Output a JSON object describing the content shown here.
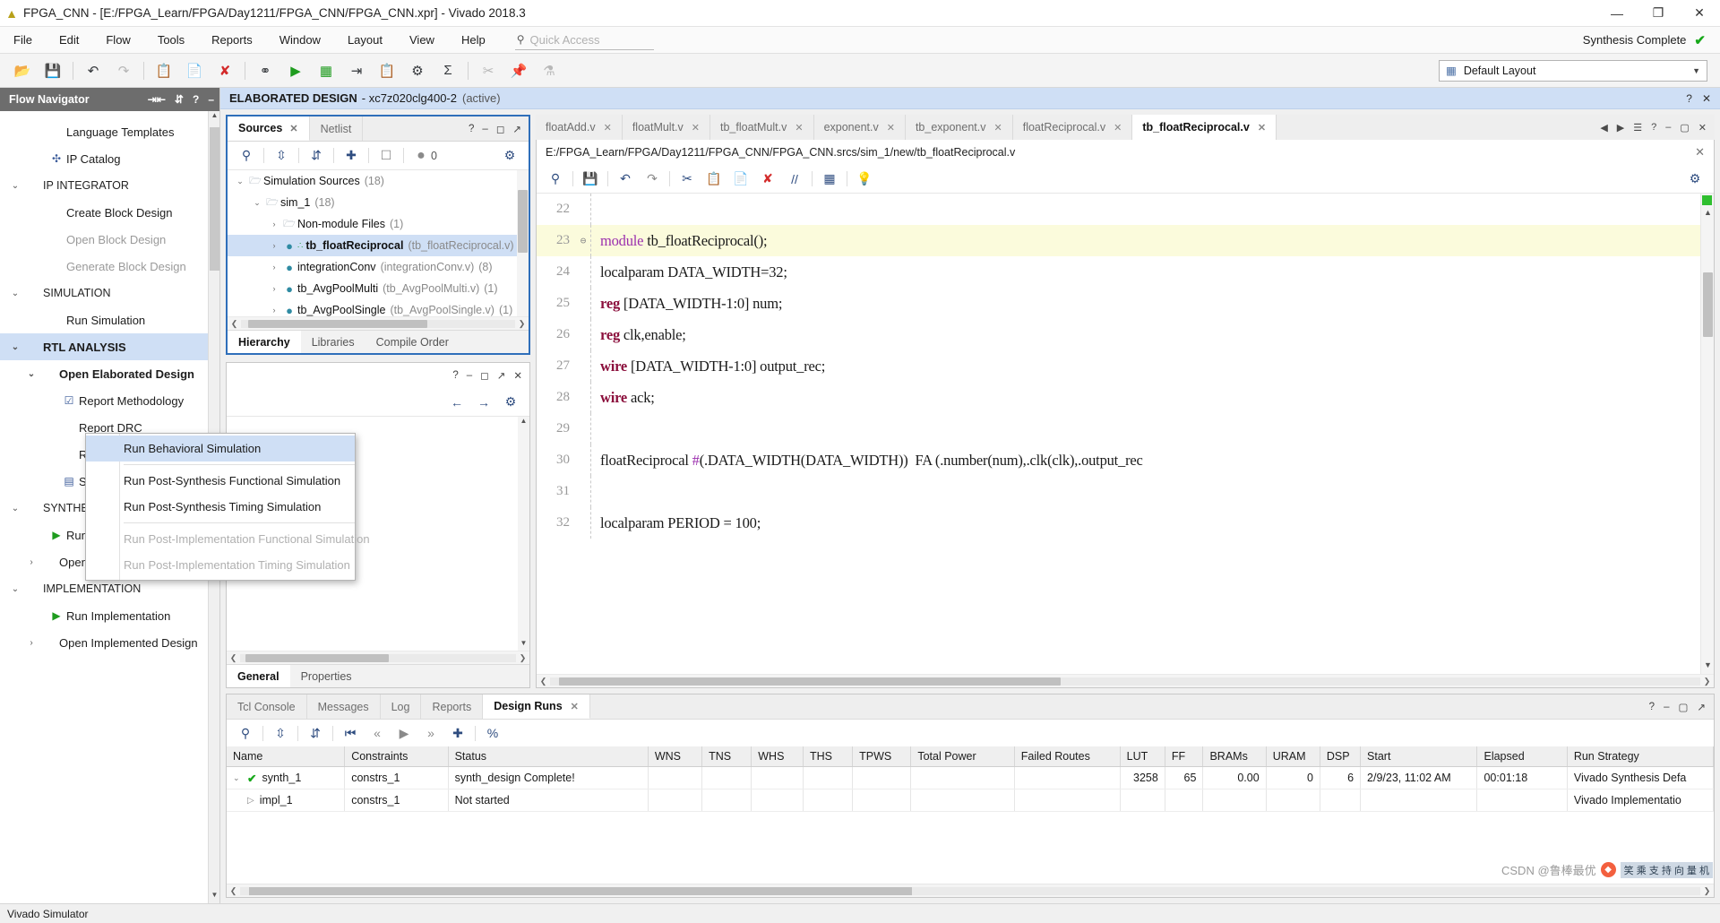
{
  "window": {
    "title": "FPGA_CNN - [E:/FPGA_Learn/FPGA/Day1211/FPGA_CNN/FPGA_CNN.xpr] - Vivado 2018.3",
    "minimize": "—",
    "maximize": "❐",
    "close": "✕"
  },
  "menubar": {
    "items": [
      "File",
      "Edit",
      "Flow",
      "Tools",
      "Reports",
      "Window",
      "Layout",
      "View",
      "Help"
    ],
    "quick_access_placeholder": "Quick Access",
    "status_text": "Synthesis Complete",
    "status_check": "✔"
  },
  "toolbar": {
    "layout_label": "Default Layout",
    "buttons": [
      "open-icon",
      "save-icon",
      "undo-icon",
      "redo-icon",
      "copy-icon",
      "paste-icon",
      "delete-icon",
      "link-icon",
      "run-icon",
      "run-sim-icon",
      "step-icon",
      "report-icon",
      "settings-icon",
      "sum-icon",
      "cut-icon",
      "pin-icon",
      "filter-icon"
    ]
  },
  "flow_navigator": {
    "title": "Flow Navigator",
    "items": [
      {
        "label": "Language Templates",
        "indent": 1,
        "icon": "",
        "state": "normal"
      },
      {
        "label": "IP Catalog",
        "indent": 1,
        "icon": "ip-icon",
        "state": "normal"
      },
      {
        "label": "IP INTEGRATOR",
        "indent": 0,
        "icon": "chevron-down",
        "state": "section"
      },
      {
        "label": "Create Block Design",
        "indent": 1,
        "icon": "",
        "state": "normal"
      },
      {
        "label": "Open Block Design",
        "indent": 1,
        "icon": "",
        "state": "dim"
      },
      {
        "label": "Generate Block Design",
        "indent": 1,
        "icon": "",
        "state": "dim"
      },
      {
        "label": "SIMULATION",
        "indent": 0,
        "icon": "chevron-down",
        "state": "section"
      },
      {
        "label": "Run Simulation",
        "indent": 1,
        "icon": "",
        "state": "normal"
      },
      {
        "label": "RTL ANALYSIS",
        "indent": 0,
        "icon": "chevron-down",
        "state": "selected"
      },
      {
        "label": "Open Elaborated Design",
        "indent": 1,
        "icon": "chevron-down",
        "state": "bold"
      },
      {
        "label": "Report Methodology",
        "indent": 2,
        "icon": "report-icon",
        "state": "normal"
      },
      {
        "label": "Report DRC",
        "indent": 2,
        "icon": "",
        "state": "normal"
      },
      {
        "label": "Report Noise",
        "indent": 2,
        "icon": "",
        "state": "normal"
      },
      {
        "label": "Schematic",
        "indent": 2,
        "icon": "schematic-icon",
        "state": "normal"
      },
      {
        "label": "SYNTHESIS",
        "indent": 0,
        "icon": "chevron-down",
        "state": "section"
      },
      {
        "label": "Run Synthesis",
        "indent": 1,
        "icon": "play-icon",
        "state": "normal"
      },
      {
        "label": "Open Synthesized Design",
        "indent": 1,
        "icon": "chevron-right",
        "state": "normal"
      },
      {
        "label": "IMPLEMENTATION",
        "indent": 0,
        "icon": "chevron-down",
        "state": "section"
      },
      {
        "label": "Run Implementation",
        "indent": 1,
        "icon": "play-icon",
        "state": "normal"
      },
      {
        "label": "Open Implemented Design",
        "indent": 1,
        "icon": "chevron-right",
        "state": "normal"
      }
    ]
  },
  "context_menu": {
    "items": [
      {
        "label": "Run Behavioral Simulation",
        "state": "selected"
      },
      {
        "label": "__sep__",
        "state": "sep"
      },
      {
        "label": "Run Post-Synthesis Functional Simulation",
        "state": "normal"
      },
      {
        "label": "Run Post-Synthesis Timing Simulation",
        "state": "normal"
      },
      {
        "label": "__sep__",
        "state": "sep"
      },
      {
        "label": "Run Post-Implementation Functional Simulation",
        "state": "dim"
      },
      {
        "label": "Run Post-Implementation Timing Simulation",
        "state": "dim"
      }
    ]
  },
  "elaborated_banner": {
    "title": "ELABORATED DESIGN",
    "device": "- xc7z020clg400-2",
    "active": "(active)",
    "help": "?",
    "close": "✕"
  },
  "sources_panel": {
    "tabs": [
      {
        "label": "Sources",
        "active": true,
        "closable": true
      },
      {
        "label": "Netlist",
        "active": false,
        "closable": false
      }
    ],
    "toolbar_badge": "0",
    "tree": [
      {
        "label": "Simulation Sources",
        "count": "(18)",
        "indent": 0,
        "icon": "folder-icon",
        "chev": "v",
        "bold": false,
        "selected": false,
        "sub": ""
      },
      {
        "label": "sim_1",
        "count": "(18)",
        "indent": 1,
        "icon": "folder-icon",
        "chev": "v",
        "bold": false,
        "selected": false,
        "sub": ""
      },
      {
        "label": "Non-module Files",
        "count": "(1)",
        "indent": 2,
        "icon": "folder-icon",
        "chev": ">",
        "bold": false,
        "selected": false,
        "sub": ""
      },
      {
        "label": "tb_floatReciprocal",
        "count": "",
        "indent": 2,
        "icon": "module-icon",
        "chev": ">",
        "bold": true,
        "selected": true,
        "sub": "(tb_floatReciprocal.v)"
      },
      {
        "label": "integrationConv",
        "count": "(8)",
        "indent": 2,
        "icon": "dot-icon",
        "chev": ">",
        "bold": false,
        "selected": false,
        "sub": "(integrationConv.v)"
      },
      {
        "label": "tb_AvgPoolMulti",
        "count": "(1)",
        "indent": 2,
        "icon": "dot-icon",
        "chev": ">",
        "bold": false,
        "selected": false,
        "sub": "(tb_AvgPoolMulti.v)"
      },
      {
        "label": "tb_AvgPoolSingle",
        "count": "(1)",
        "indent": 2,
        "icon": "dot-icon",
        "chev": ">",
        "bold": false,
        "selected": false,
        "sub": "(tb_AvgPoolSingle.v)"
      }
    ],
    "bottom_tabs": [
      {
        "label": "Hierarchy",
        "active": true
      },
      {
        "label": "Libraries",
        "active": false
      },
      {
        "label": "Compile Order",
        "active": false
      }
    ]
  },
  "properties_panel": {
    "bottom_tabs": [
      {
        "label": "General",
        "active": true
      },
      {
        "label": "Properties",
        "active": false
      }
    ]
  },
  "editor": {
    "tabs": [
      {
        "label": "floatAdd.v",
        "active": false
      },
      {
        "label": "floatMult.v",
        "active": false
      },
      {
        "label": "tb_floatMult.v",
        "active": false
      },
      {
        "label": "exponent.v",
        "active": false
      },
      {
        "label": "tb_exponent.v",
        "active": false
      },
      {
        "label": "floatReciprocal.v",
        "active": false
      },
      {
        "label": "tb_floatReciprocal.v",
        "active": true
      }
    ],
    "file_path": "E:/FPGA_Learn/FPGA/Day1211/FPGA_CNN/FPGA_CNN.srcs/sim_1/new/tb_floatReciprocal.v",
    "lines": [
      {
        "no": "22",
        "fold": "",
        "highlight": false,
        "segments": []
      },
      {
        "no": "23",
        "fold": "⊖",
        "highlight": true,
        "segments": [
          {
            "t": "module",
            "c": "kwp"
          },
          {
            "t": " tb_floatReciprocal();",
            "c": "pl"
          }
        ]
      },
      {
        "no": "24",
        "fold": "",
        "highlight": false,
        "segments": [
          {
            "t": "localparam DATA_WIDTH=32;",
            "c": "pl"
          }
        ]
      },
      {
        "no": "25",
        "fold": "",
        "highlight": false,
        "segments": [
          {
            "t": "reg",
            "c": "kw"
          },
          {
            "t": " [DATA_WIDTH-1:0] num;",
            "c": "pl"
          }
        ]
      },
      {
        "no": "26",
        "fold": "",
        "highlight": false,
        "segments": [
          {
            "t": "reg",
            "c": "kw"
          },
          {
            "t": " clk,enable;",
            "c": "pl"
          }
        ]
      },
      {
        "no": "27",
        "fold": "",
        "highlight": false,
        "segments": [
          {
            "t": "wire",
            "c": "kw"
          },
          {
            "t": " [DATA_WIDTH-1:0] output_rec;",
            "c": "pl"
          }
        ]
      },
      {
        "no": "28",
        "fold": "",
        "highlight": false,
        "segments": [
          {
            "t": "wire",
            "c": "kw"
          },
          {
            "t": " ack;",
            "c": "pl"
          }
        ]
      },
      {
        "no": "29",
        "fold": "",
        "highlight": false,
        "segments": []
      },
      {
        "no": "30",
        "fold": "",
        "highlight": false,
        "segments": [
          {
            "t": "floatReciprocal ",
            "c": "pl"
          },
          {
            "t": "#",
            "c": "kwp"
          },
          {
            "t": "(.DATA_WIDTH(DATA_WIDTH))  FA (.number(num),.clk(clk),.output_rec",
            "c": "pl"
          }
        ]
      },
      {
        "no": "31",
        "fold": "",
        "highlight": false,
        "segments": []
      },
      {
        "no": "32",
        "fold": "",
        "highlight": false,
        "segments": [
          {
            "t": "localparam PERIOD = 100;",
            "c": "pl"
          }
        ]
      }
    ]
  },
  "dock": {
    "tabs": [
      {
        "label": "Tcl Console",
        "active": false,
        "closable": false
      },
      {
        "label": "Messages",
        "active": false,
        "closable": false
      },
      {
        "label": "Log",
        "active": false,
        "closable": false
      },
      {
        "label": "Reports",
        "active": false,
        "closable": false
      },
      {
        "label": "Design Runs",
        "active": true,
        "closable": true
      }
    ],
    "columns": [
      "Name",
      "Constraints",
      "Status",
      "WNS",
      "TNS",
      "WHS",
      "THS",
      "TPWS",
      "Total Power",
      "Failed Routes",
      "LUT",
      "FF",
      "BRAMs",
      "URAM",
      "DSP",
      "Start",
      "Elapsed",
      "Run Strategy"
    ],
    "rows": [
      {
        "expandable": true,
        "status_icon": "check",
        "name": "synth_1",
        "Constraints": "constrs_1",
        "Status": "synth_design Complete!",
        "WNS": "",
        "TNS": "",
        "WHS": "",
        "THS": "",
        "TPWS": "",
        "Total Power": "",
        "Failed Routes": "",
        "LUT": "3258",
        "FF": "65",
        "BRAMs": "0.00",
        "URAM": "0",
        "DSP": "6",
        "Start": "2/9/23, 11:02 AM",
        "Elapsed": "00:01:18",
        "Run Strategy": "Vivado Synthesis Defa"
      },
      {
        "expandable": false,
        "status_icon": "triangle",
        "name": "impl_1",
        "Constraints": "constrs_1",
        "Status": "Not started",
        "WNS": "",
        "TNS": "",
        "WHS": "",
        "THS": "",
        "TPWS": "",
        "Total Power": "",
        "Failed Routes": "",
        "LUT": "",
        "FF": "",
        "BRAMs": "",
        "URAM": "",
        "DSP": "",
        "Start": "",
        "Elapsed": "",
        "Run Strategy": "Vivado Implementatio"
      }
    ]
  },
  "statusbar": {
    "text": "Vivado Simulator"
  },
  "watermark": {
    "text": "CSDN @鲁棒最优",
    "tag": "笑 乘 支 持 向 量 机"
  },
  "colors": {
    "accent": "#2f6fba",
    "selection": "#cfdff5",
    "success": "#17a81a",
    "keyword": "#8b0f3c",
    "module_keyword": "#9b2fae",
    "highlight_line": "#fbfbdc"
  }
}
